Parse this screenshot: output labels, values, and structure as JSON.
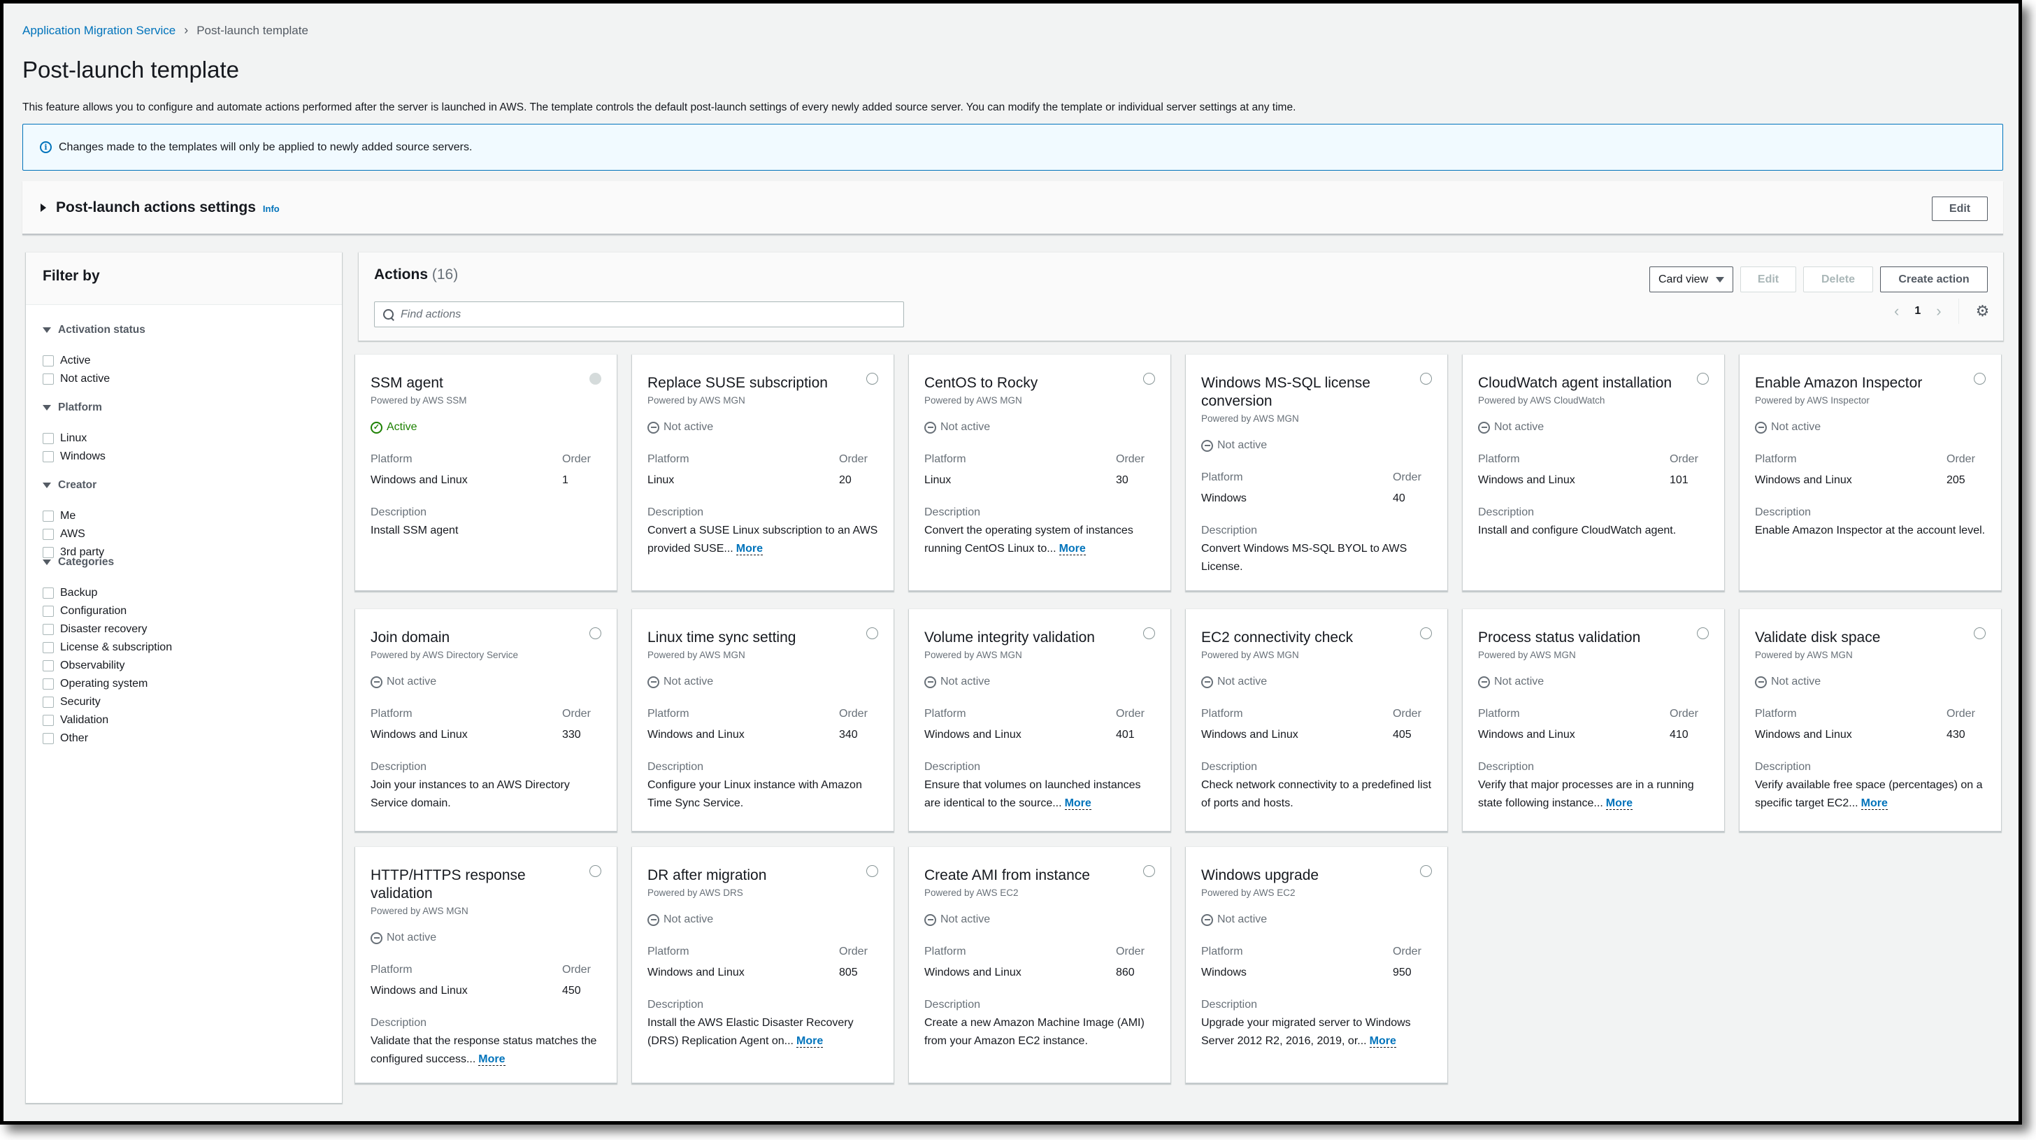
{
  "breadcrumb": {
    "items": [
      "Application Migration Service",
      "Post-launch template"
    ]
  },
  "page": {
    "title": "Post-launch template",
    "description": "This feature allows you to configure and automate actions performed after the server is launched in AWS. The template controls the default post-launch settings of every newly added source server. You can modify the template or individual server settings at any time."
  },
  "alert": {
    "icon": "info-icon",
    "text": "Changes made to the templates will only be applied to newly added source servers.",
    "color": "#0073bb"
  },
  "settings_section": {
    "title": "Post-launch actions settings",
    "info_label": "Info",
    "edit_label": "Edit"
  },
  "filter": {
    "title": "Filter by",
    "groups": [
      {
        "title": "Activation status",
        "options": [
          "Active",
          "Not active"
        ]
      },
      {
        "title": "Platform",
        "options": [
          "Linux",
          "Windows"
        ]
      },
      {
        "title": "Creator",
        "options": [
          "Me",
          "AWS",
          "3rd party"
        ]
      },
      {
        "title": "Categories",
        "options": [
          "Backup",
          "Configuration",
          "Disaster recovery",
          "License & subscription",
          "Observability",
          "Operating system",
          "Security",
          "Validation",
          "Other"
        ]
      }
    ]
  },
  "actions": {
    "title": "Actions",
    "count": "(16)",
    "search_placeholder": "Find actions",
    "view_select": "Card view",
    "edit_label": "Edit",
    "delete_label": "Delete",
    "create_label": "Create action",
    "page": "1",
    "labels": {
      "platform": "Platform",
      "order": "Order",
      "description": "Description",
      "more": "More"
    },
    "colors": {
      "active": "#1d8102",
      "link": "#0073bb"
    },
    "cards": [
      {
        "title": "SSM agent",
        "powered": "Powered by AWS SSM",
        "status": "Active",
        "platform": "Windows and Linux",
        "order": "1",
        "description": "Install SSM agent",
        "more": false,
        "selectable": false
      },
      {
        "title": "Replace SUSE subscription",
        "powered": "Powered by AWS MGN",
        "status": "Not active",
        "platform": "Linux",
        "order": "20",
        "description": "Convert a SUSE Linux subscription to an AWS provided SUSE...",
        "more": true,
        "selectable": true
      },
      {
        "title": "CentOS to Rocky",
        "powered": "Powered by AWS MGN",
        "status": "Not active",
        "platform": "Linux",
        "order": "30",
        "description": "Convert the operating system of instances running CentOS Linux to...",
        "more": true,
        "selectable": true
      },
      {
        "title": "Windows MS-SQL license conversion",
        "powered": "Powered by AWS MGN",
        "status": "Not active",
        "platform": "Windows",
        "order": "40",
        "description": "Convert Windows MS-SQL BYOL to AWS License.",
        "more": false,
        "selectable": true
      },
      {
        "title": "CloudWatch agent installation",
        "powered": "Powered by AWS CloudWatch",
        "status": "Not active",
        "platform": "Windows and Linux",
        "order": "101",
        "description": "Install and configure CloudWatch agent.",
        "more": false,
        "selectable": true
      },
      {
        "title": "Enable Amazon Inspector",
        "powered": "Powered by AWS Inspector",
        "status": "Not active",
        "platform": "Windows and Linux",
        "order": "205",
        "description": "Enable Amazon Inspector at the account level.",
        "more": false,
        "selectable": true
      },
      {
        "title": "Join domain",
        "powered": "Powered by AWS Directory Service",
        "status": "Not active",
        "platform": "Windows and Linux",
        "order": "330",
        "description": "Join your instances to an AWS Directory Service domain.",
        "more": false,
        "selectable": true
      },
      {
        "title": "Linux time sync setting",
        "powered": "Powered by AWS MGN",
        "status": "Not active",
        "platform": "Windows and Linux",
        "order": "340",
        "description": "Configure your Linux instance with Amazon Time Sync Service.",
        "more": false,
        "selectable": true
      },
      {
        "title": "Volume integrity validation",
        "powered": "Powered by AWS MGN",
        "status": "Not active",
        "platform": "Windows and Linux",
        "order": "401",
        "description": "Ensure that volumes on launched instances are identical to the source...",
        "more": true,
        "selectable": true
      },
      {
        "title": "EC2 connectivity check",
        "powered": "Powered by AWS MGN",
        "status": "Not active",
        "platform": "Windows and Linux",
        "order": "405",
        "description": "Check network connectivity to a predefined list of ports and hosts.",
        "more": false,
        "selectable": true
      },
      {
        "title": "Process status validation",
        "powered": "Powered by AWS MGN",
        "status": "Not active",
        "platform": "Windows and Linux",
        "order": "410",
        "description": "Verify that major processes are in a running state following instance...",
        "more": true,
        "selectable": true
      },
      {
        "title": "Validate disk space",
        "powered": "Powered by AWS MGN",
        "status": "Not active",
        "platform": "Windows and Linux",
        "order": "430",
        "description": "Verify available free space (percentages) on a specific target EC2...",
        "more": true,
        "selectable": true
      },
      {
        "title": "HTTP/HTTPS response validation",
        "powered": "Powered by AWS MGN",
        "status": "Not active",
        "platform": "Windows and Linux",
        "order": "450",
        "description": "Validate that the response status matches the configured success...",
        "more": true,
        "selectable": true
      },
      {
        "title": "DR after migration",
        "powered": "Powered by AWS DRS",
        "status": "Not active",
        "platform": "Windows and Linux",
        "order": "805",
        "description": "Install the AWS Elastic Disaster Recovery (DRS) Replication Agent on...",
        "more": true,
        "selectable": true
      },
      {
        "title": "Create AMI from instance",
        "powered": "Powered by AWS EC2",
        "status": "Not active",
        "platform": "Windows and Linux",
        "order": "860",
        "description": "Create a new Amazon Machine Image (AMI) from your Amazon EC2 instance.",
        "more": false,
        "selectable": true
      },
      {
        "title": "Windows upgrade",
        "powered": "Powered by AWS EC2",
        "status": "Not active",
        "platform": "Windows",
        "order": "950",
        "description": "Upgrade your migrated server to Windows Server 2012 R2, 2016, 2019, or...",
        "more": true,
        "selectable": true
      }
    ]
  }
}
